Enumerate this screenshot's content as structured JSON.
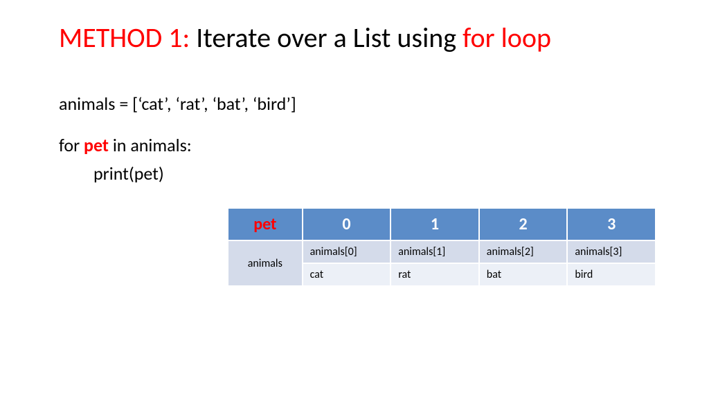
{
  "title": {
    "part1": "METHOD 1:",
    "part2": " Iterate over a List using ",
    "part3": "for loop"
  },
  "code": {
    "line1": "animals = [‘cat’, ‘rat’, ‘bat’, ‘bird’]",
    "line2a": "for ",
    "line2b": "pet",
    "line2c": " in animals:",
    "line3": "print(pet)"
  },
  "table": {
    "header": {
      "c0": "pet",
      "c1": "0",
      "c2": "1",
      "c3": "2",
      "c4": "3"
    },
    "rowLabel": "animals",
    "refs": {
      "c1": "animals[0]",
      "c2": "animals[1]",
      "c3": "animals[2]",
      "c4": "animals[3]"
    },
    "vals": {
      "c1": "cat",
      "c2": "rat",
      "c3": "bat",
      "c4": "bird"
    }
  }
}
